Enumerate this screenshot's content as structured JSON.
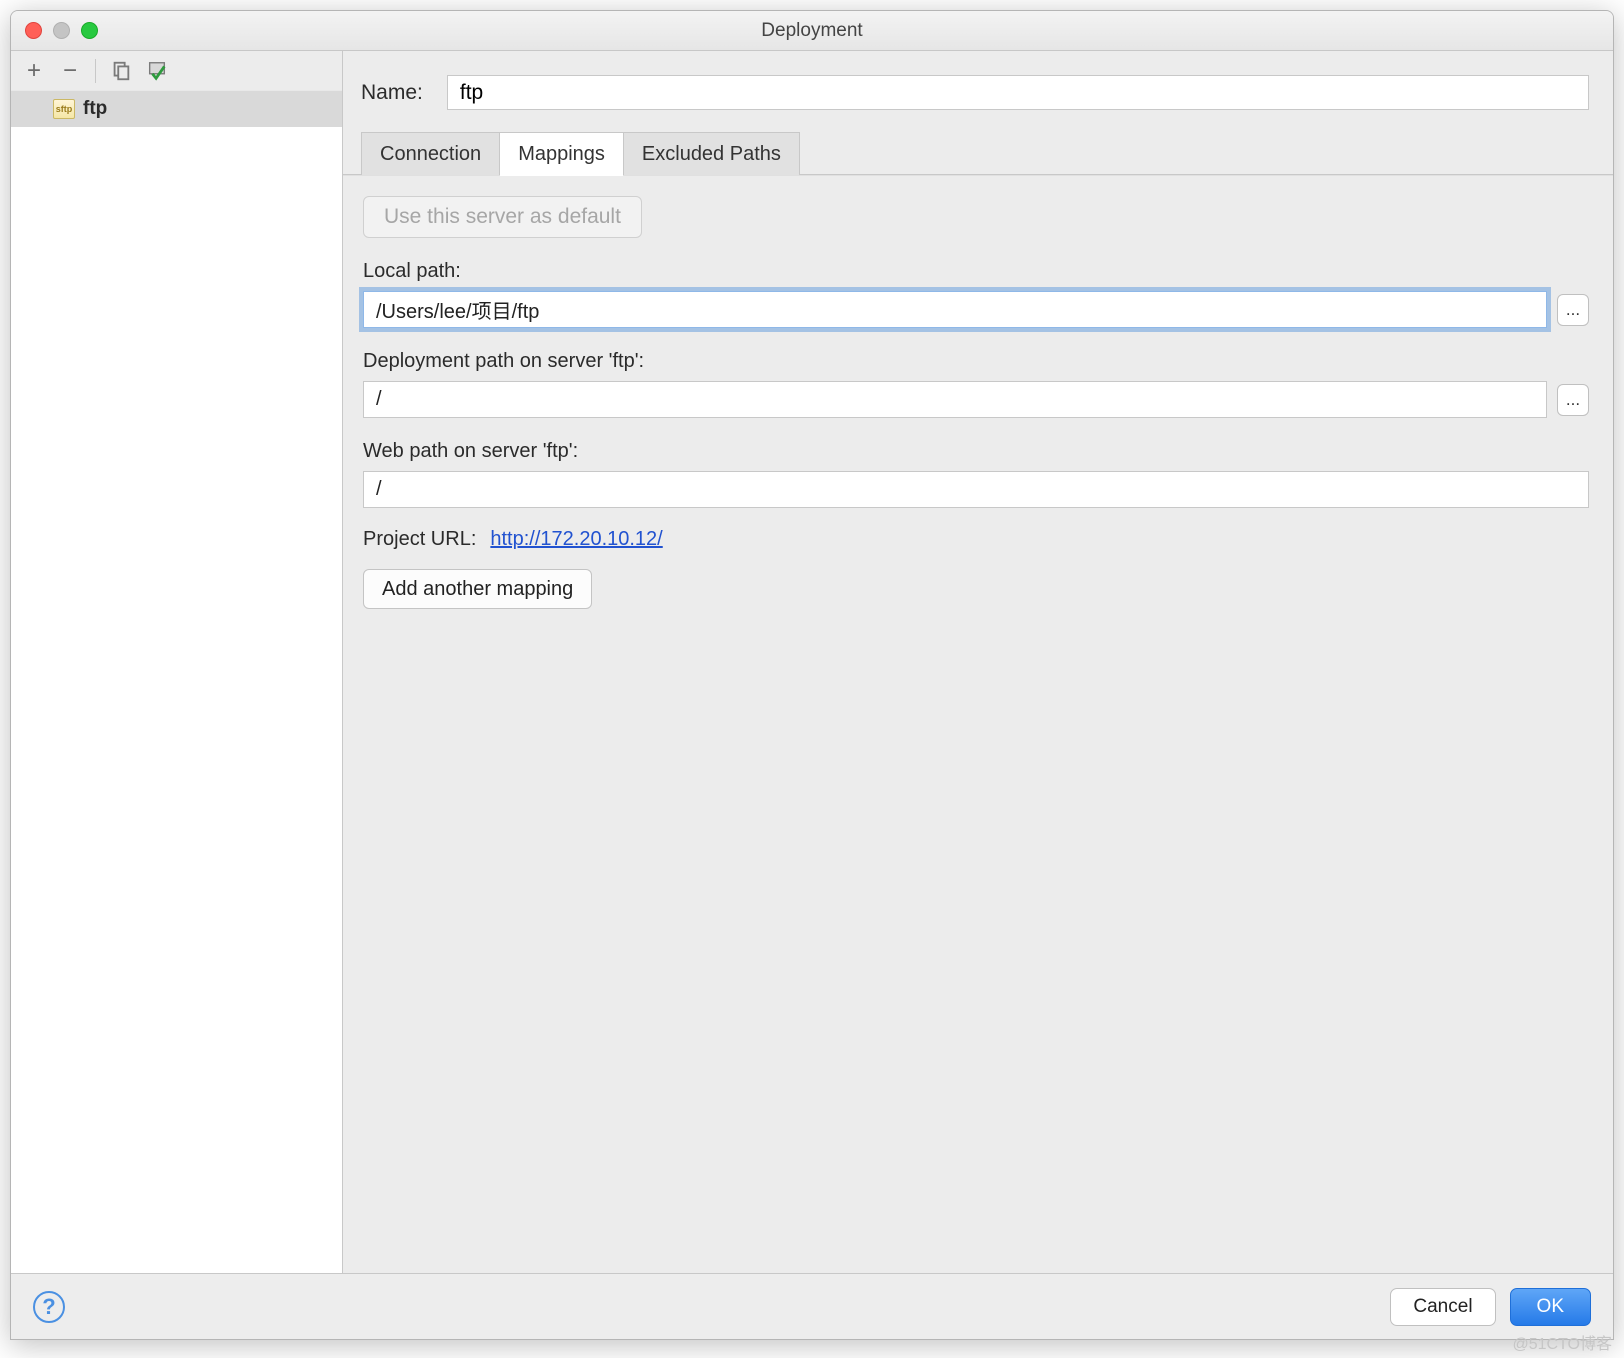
{
  "window": {
    "title": "Deployment"
  },
  "sidebar": {
    "server_name": "ftp",
    "server_type_badge": "sftp"
  },
  "name": {
    "label": "Name:",
    "value": "ftp"
  },
  "tabs": [
    {
      "label": "Connection",
      "active": false
    },
    {
      "label": "Mappings",
      "active": true
    },
    {
      "label": "Excluded Paths",
      "active": false
    }
  ],
  "form": {
    "default_server_btn": "Use this server as default",
    "local_path": {
      "label": "Local path:",
      "value": "/Users/lee/项目/ftp"
    },
    "deployment_path": {
      "label": "Deployment path on server 'ftp':",
      "value": "/"
    },
    "web_path": {
      "label": "Web path on server 'ftp':",
      "value": "/"
    },
    "project_url": {
      "label": "Project URL:",
      "link": "http://172.20.10.12/"
    },
    "add_mapping_btn": "Add another mapping"
  },
  "footer": {
    "cancel": "Cancel",
    "ok": "OK"
  },
  "watermark": "@51CTO博客",
  "browse_btn_label": "..."
}
